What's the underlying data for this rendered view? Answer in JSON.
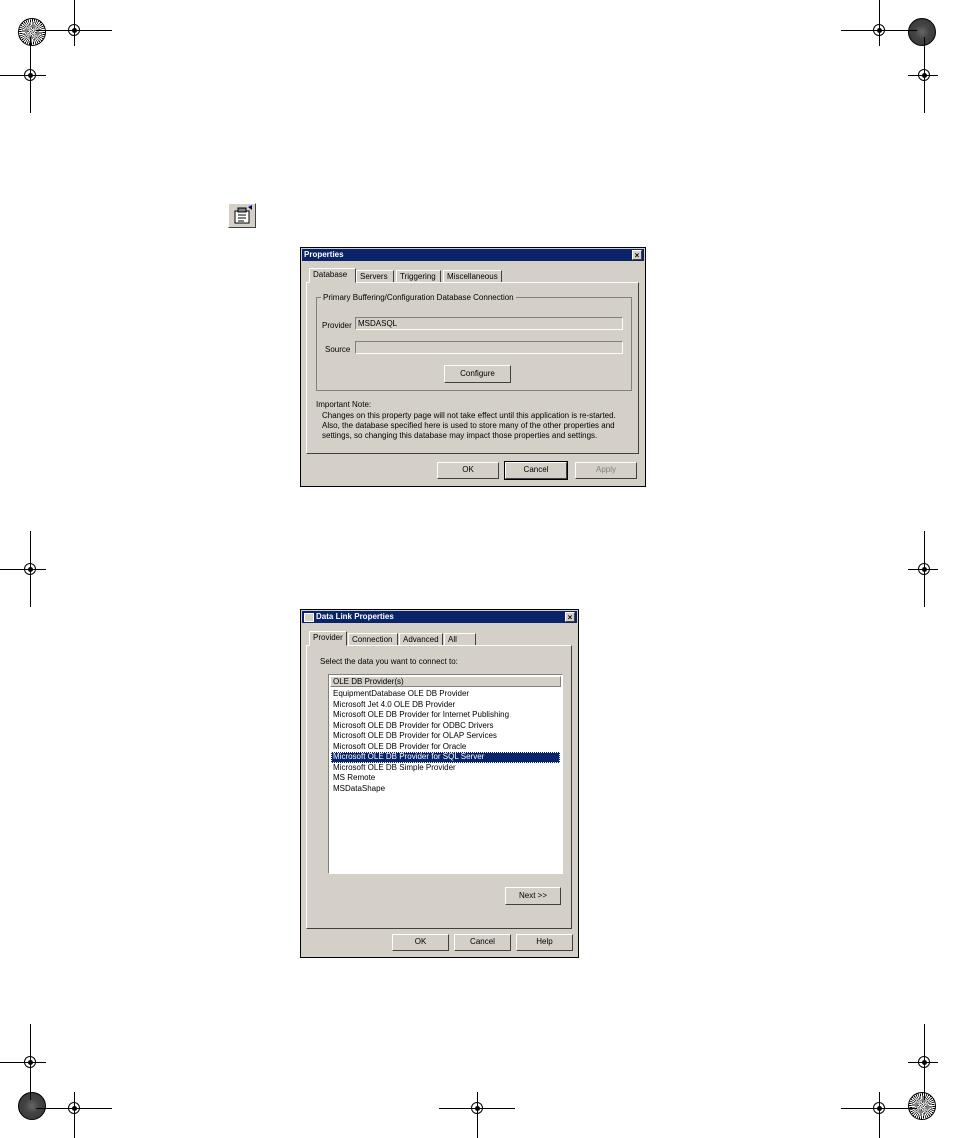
{
  "properties_dialog": {
    "title": "Properties",
    "close_glyph": "×",
    "tabs": [
      "Database",
      "Servers",
      "Triggering",
      "Miscellaneous"
    ],
    "active_tab": "Database",
    "group_label": "Primary Buffering/Configuration Database Connection",
    "provider_label": "Provider",
    "provider_value": "MSDASQL",
    "source_label": "Source",
    "source_value": "",
    "configure_button": "Configure",
    "note_heading": "Important Note:",
    "note_lines": [
      "Changes on this property page will not take effect until this application is re-started.",
      "Also, the database specified here is used to store many of the other properties and",
      "settings, so changing this database may impact those properties and settings."
    ],
    "ok_button": "OK",
    "cancel_button": "Cancel",
    "apply_button": "Apply"
  },
  "data_link_dialog": {
    "title": "Data Link Properties",
    "close_glyph": "×",
    "tabs": [
      "Provider",
      "Connection",
      "Advanced",
      "All"
    ],
    "active_tab": "Provider",
    "instruction": "Select the data you want to connect to:",
    "list_header": "OLE DB Provider(s)",
    "providers": [
      "EquipmentDatabase OLE DB Provider",
      "Microsoft Jet 4.0 OLE DB Provider",
      "Microsoft OLE DB Provider for Internet Publishing",
      "Microsoft OLE DB Provider for ODBC Drivers",
      "Microsoft OLE DB Provider for OLAP Services",
      "Microsoft OLE DB Provider for Oracle",
      "Microsoft OLE DB Provider for SQL Server",
      "Microsoft OLE DB Simple Provider",
      "MS Remote",
      "MSDataShape"
    ],
    "selected_provider": "Microsoft OLE DB Provider for SQL Server",
    "next_button": "Next >>",
    "ok_button": "OK",
    "cancel_button": "Cancel",
    "help_button": "Help"
  },
  "icons": {
    "toolbar": "properties-icon",
    "registration": "registration-mark-icon",
    "color_target": "color-target-icon"
  },
  "colors": {
    "dialog_face": "#d4d0c8",
    "title_bar": "#0a246a",
    "selection": "#0a246a"
  }
}
